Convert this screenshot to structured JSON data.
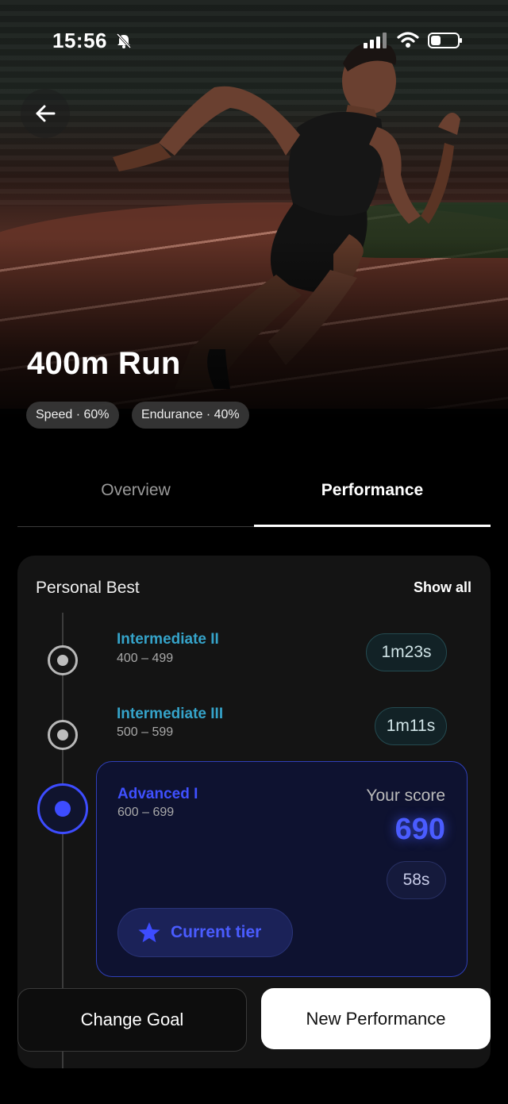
{
  "status_bar": {
    "time": "15:56"
  },
  "hero": {
    "title": "400m Run",
    "chips": [
      "Speed · 60%",
      "Endurance · 40%"
    ]
  },
  "tabs": [
    {
      "label": "Overview",
      "active": false
    },
    {
      "label": "Performance",
      "active": true
    }
  ],
  "personal_best": {
    "title": "Personal Best",
    "show_all": "Show all",
    "tiers": [
      {
        "name": "Intermediate II",
        "range": "400 – 499",
        "time": "1m23s"
      },
      {
        "name": "Intermediate III",
        "range": "500 – 599",
        "time": "1m11s"
      },
      {
        "name": "Advanced I",
        "range": "600 – 699",
        "time": "58s"
      }
    ],
    "your_score_label": "Your score",
    "your_score": "690",
    "current_tier_label": "Current tier"
  },
  "actions": {
    "change_goal": "Change Goal",
    "new_performance": "New Performance"
  },
  "colors": {
    "accent_blue": "#3d4cff",
    "tier_teal": "#35a3c9",
    "background": "#000000",
    "card": "#141414"
  }
}
